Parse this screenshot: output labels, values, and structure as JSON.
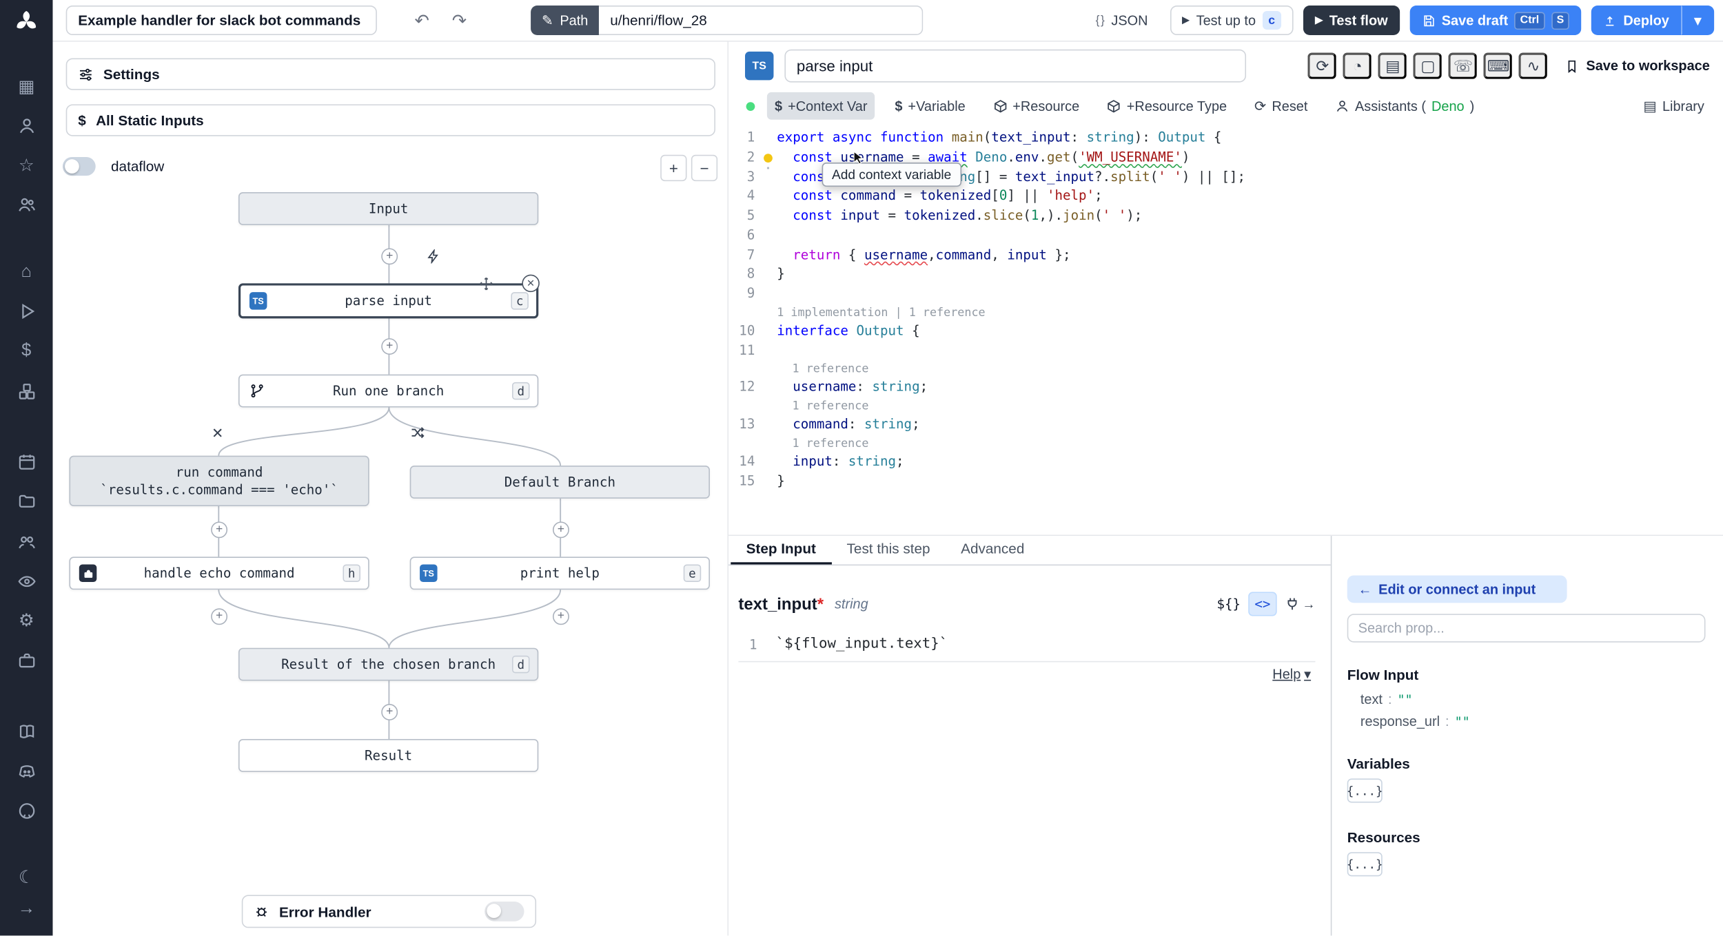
{
  "icons": {
    "undo": "↶",
    "redo": "↷",
    "pencil": "✎",
    "play": "▶",
    "caret": "▾",
    "plus": "+",
    "minus": "−",
    "close": "✕",
    "arrow_left": "←",
    "arrow_right": "→",
    "grid": "▦",
    "star": "☆",
    "home": "⌂",
    "dollar": "$",
    "gear": "⚙",
    "moon": "☾",
    "refresh": "⟳",
    "gauge": "◔",
    "book": "▤",
    "square": "▢",
    "phone": "☏",
    "keyboard": "⌨",
    "wave": "∿"
  },
  "topbar": {
    "title": "Example handler for slack bot commands",
    "path_label": "Path",
    "path_value": "u/henri/flow_28",
    "json_label": "JSON",
    "test_up_to_label": "Test up to",
    "test_up_to_badge": "c",
    "test_flow_label": "Test flow",
    "save_draft_label": "Save draft",
    "kbd_ctrl": "Ctrl",
    "kbd_s": "S",
    "deploy_label": "Deploy"
  },
  "flow": {
    "settings_label": "Settings",
    "static_inputs_label": "All Static Inputs",
    "dataflow_label": "dataflow",
    "error_handler_label": "Error Handler",
    "nodes": {
      "input": "Input",
      "parse_input": "parse input",
      "parse_input_badge": "c",
      "run_one_branch": "Run one branch",
      "run_one_branch_badge": "d",
      "run_command_line1": "run command",
      "run_command_line2": "`results.c.command === 'echo'`",
      "default_branch": "Default Branch",
      "handle_echo": "handle echo command",
      "handle_echo_badge": "h",
      "print_help": "print help",
      "print_help_badge": "e",
      "result_chosen": "Result of the chosen branch",
      "result_chosen_badge": "d",
      "result": "Result",
      "ts_badge": "TS"
    }
  },
  "editor": {
    "script_name": "parse input",
    "save_to_workspace": "Save to workspace",
    "toolbar": {
      "dollar": "$",
      "context_var": "+Context Var",
      "variable": "+Variable",
      "resource": "+Resource",
      "resource_type": "+Resource Type",
      "reset": "Reset",
      "assistants_pre": "Assistants (",
      "assistants_lang": "Deno",
      "assistants_post": ")",
      "library": "Library",
      "tooltip": "Add context variable"
    }
  },
  "code": {
    "rows": [
      {
        "n": "1",
        "t": [
          [
            "kw",
            "export"
          ],
          [
            "pl",
            " "
          ],
          [
            "kw",
            "async"
          ],
          [
            "pl",
            " "
          ],
          [
            "kw",
            "function"
          ],
          [
            "pl",
            " "
          ],
          [
            "fn",
            "main"
          ],
          [
            "pu",
            "("
          ],
          [
            "va",
            "text_input"
          ],
          [
            "pu",
            ": "
          ],
          [
            "ty",
            "string"
          ],
          [
            "pu",
            "): "
          ],
          [
            "ty",
            "Output"
          ],
          [
            "pu",
            " {"
          ]
        ]
      },
      {
        "n": "2",
        "bulb": true,
        "t": [
          [
            "pl",
            "  "
          ],
          [
            "kw",
            "const"
          ],
          [
            "pl",
            " "
          ],
          [
            "va",
            "username"
          ],
          [
            "pu",
            " = "
          ],
          [
            "kw sqg",
            "await"
          ],
          [
            "pl",
            " "
          ],
          [
            "ty",
            "Deno"
          ],
          [
            "pu",
            "."
          ],
          [
            "va",
            "env"
          ],
          [
            "pu",
            "."
          ],
          [
            "fn",
            "get"
          ],
          [
            "pu",
            "("
          ],
          [
            "st sqg",
            "'WM_USERNAME'"
          ],
          [
            "pu",
            ")"
          ]
        ]
      },
      {
        "n": "3",
        "t": [
          [
            "pl",
            "  "
          ],
          [
            "kw",
            "const"
          ],
          [
            "pl",
            " "
          ],
          [
            "va",
            "tokenized"
          ],
          [
            "pu",
            ": "
          ],
          [
            "ty",
            "string"
          ],
          [
            "pu",
            "[] = "
          ],
          [
            "va",
            "text_input"
          ],
          [
            "pu",
            "?."
          ],
          [
            "fn",
            "split"
          ],
          [
            "pu",
            "("
          ],
          [
            "st",
            "' '"
          ],
          [
            "pu",
            ") || [];"
          ]
        ]
      },
      {
        "n": "4",
        "t": [
          [
            "pl",
            "  "
          ],
          [
            "kw",
            "const"
          ],
          [
            "pl",
            " "
          ],
          [
            "va",
            "command"
          ],
          [
            "pu",
            " = "
          ],
          [
            "va",
            "tokenized"
          ],
          [
            "pu",
            "["
          ],
          [
            "nu",
            "0"
          ],
          [
            "pu",
            "] || "
          ],
          [
            "st",
            "'help'"
          ],
          [
            "pu",
            ";"
          ]
        ]
      },
      {
        "n": "5",
        "t": [
          [
            "pl",
            "  "
          ],
          [
            "kw",
            "const"
          ],
          [
            "pl",
            " "
          ],
          [
            "va",
            "input"
          ],
          [
            "pu",
            " = "
          ],
          [
            "va",
            "tokenized"
          ],
          [
            "pu",
            "."
          ],
          [
            "fn",
            "slice"
          ],
          [
            "pu",
            "("
          ],
          [
            "nu",
            "1"
          ],
          [
            "pu",
            ",)."
          ],
          [
            "fn",
            "join"
          ],
          [
            "pu",
            "("
          ],
          [
            "st",
            "' '"
          ],
          [
            "pu",
            ");"
          ]
        ]
      },
      {
        "n": "6",
        "t": []
      },
      {
        "n": "7",
        "t": [
          [
            "pl",
            "  "
          ],
          [
            "kwc",
            "return"
          ],
          [
            "pu",
            " { "
          ],
          [
            "va sqr",
            "username"
          ],
          [
            "pu",
            ","
          ],
          [
            "va",
            "command"
          ],
          [
            "pu",
            ", "
          ],
          [
            "va",
            "input"
          ],
          [
            "pu",
            " };"
          ]
        ]
      },
      {
        "n": "8",
        "t": [
          [
            "pu",
            "}"
          ]
        ]
      },
      {
        "n": "9",
        "t": []
      },
      {
        "lens": true,
        "t": [
          [
            "lens",
            "1 implementation | 1 reference"
          ]
        ]
      },
      {
        "n": "10",
        "t": [
          [
            "kw",
            "interface"
          ],
          [
            "pl",
            " "
          ],
          [
            "ty",
            "Output"
          ],
          [
            "pu",
            " {"
          ]
        ]
      },
      {
        "n": "11",
        "t": []
      },
      {
        "lens": true,
        "ind": true,
        "t": [
          [
            "lens",
            "1 reference"
          ]
        ]
      },
      {
        "n": "12",
        "t": [
          [
            "pl",
            "  "
          ],
          [
            "va",
            "username"
          ],
          [
            "pu",
            ": "
          ],
          [
            "ty",
            "string"
          ],
          [
            "pu",
            ";"
          ]
        ]
      },
      {
        "lens": true,
        "ind": true,
        "t": [
          [
            "lens",
            "1 reference"
          ]
        ]
      },
      {
        "n": "13",
        "t": [
          [
            "pl",
            "  "
          ],
          [
            "va",
            "command"
          ],
          [
            "pu",
            ": "
          ],
          [
            "ty",
            "string"
          ],
          [
            "pu",
            ";"
          ]
        ]
      },
      {
        "lens": true,
        "ind": true,
        "t": [
          [
            "lens",
            "1 reference"
          ]
        ]
      },
      {
        "n": "14",
        "t": [
          [
            "pl",
            "  "
          ],
          [
            "va",
            "input"
          ],
          [
            "pu",
            ": "
          ],
          [
            "ty",
            "string"
          ],
          [
            "pu",
            ";"
          ]
        ]
      },
      {
        "n": "15",
        "t": [
          [
            "pu",
            "}"
          ]
        ]
      }
    ]
  },
  "bottom": {
    "tabs": [
      "Step Input",
      "Test this step",
      "Advanced"
    ],
    "field": {
      "name": "text_input",
      "required": "*",
      "type": "string",
      "dollar_badge": "${}",
      "code_badge": "<>",
      "help": "Help"
    },
    "editor_line_no": "1",
    "editor_code": "`${flow_input.text}`"
  },
  "props": {
    "edit_button": "Edit or connect an input",
    "search_placeholder": "Search prop...",
    "flow_input_title": "Flow Input",
    "rows": [
      {
        "key": "text",
        "sep": ":",
        "value": "\"\""
      },
      {
        "key": "response_url",
        "sep": ":",
        "value": "\"\""
      }
    ],
    "variables_title": "Variables",
    "resources_title": "Resources",
    "braces": "{...}"
  }
}
